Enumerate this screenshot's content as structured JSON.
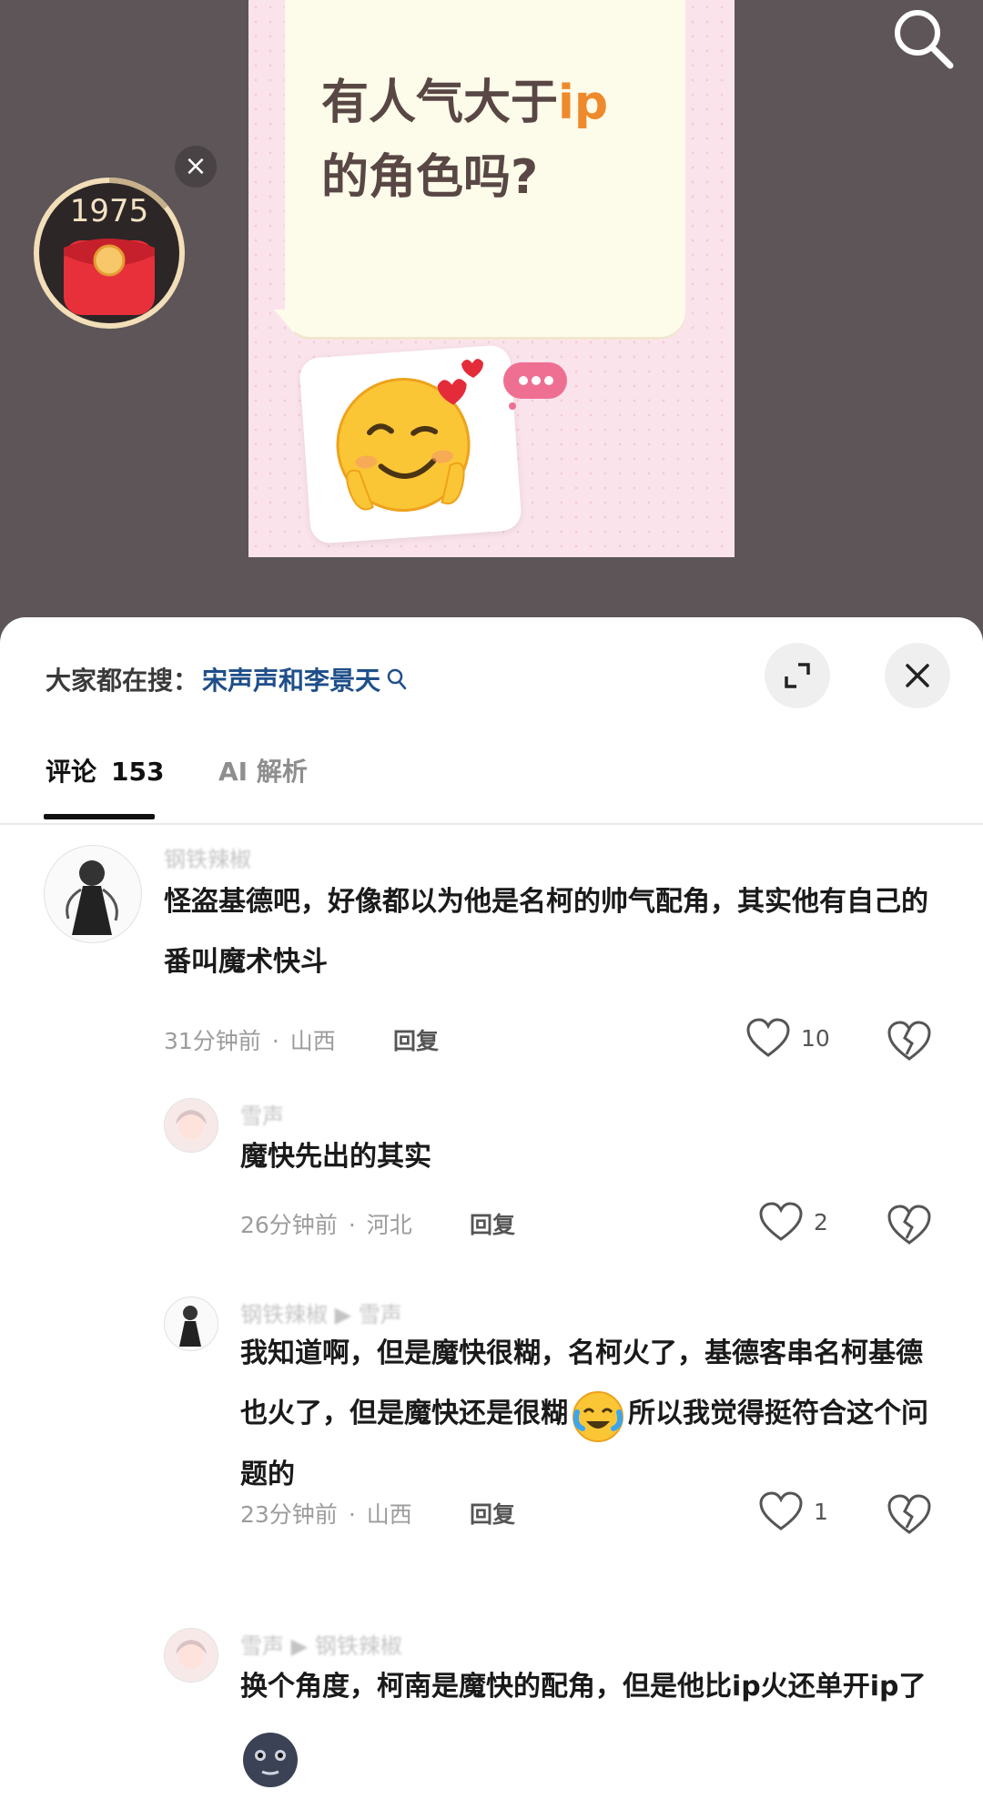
{
  "video": {
    "redpacket_count": "1975",
    "poster": {
      "line1_prefix": "有人气大于",
      "line1_accent": "ip",
      "line2": "的角色吗?"
    }
  },
  "sheet": {
    "hot_prefix": "大家都在搜：",
    "hot_link": "宋声声和李景天",
    "tabs": [
      {
        "label": "评论",
        "count": "153"
      },
      {
        "label": "AI 解析"
      }
    ]
  },
  "comments": [
    {
      "username": "钢铁辣椒",
      "text": "怪盗基德吧，好像都以为他是名柯的帅气配角，其实他有自己的番叫魔术快斗",
      "time": "31分钟前",
      "location": "山西",
      "reply": "回复",
      "likes": "10"
    },
    {
      "username": "雪声",
      "text": "魔快先出的其实",
      "time": "26分钟前",
      "location": "河北",
      "reply": "回复",
      "likes": "2"
    },
    {
      "username": "钢铁辣椒 ▶ 雪声",
      "text_before": "我知道啊，但是魔快很糊，名柯火了，基德客串名柯基德也火了，但是魔快还是很糊",
      "text_after": "所以我觉得挺符合这个问题的",
      "time": "23分钟前",
      "location": "山西",
      "reply": "回复",
      "likes": "1"
    },
    {
      "username": "雪声 ▶ 钢铁辣椒",
      "text": "换个角度，柯南是魔快的配角，但是他比ip火还单开ip了"
    }
  ]
}
